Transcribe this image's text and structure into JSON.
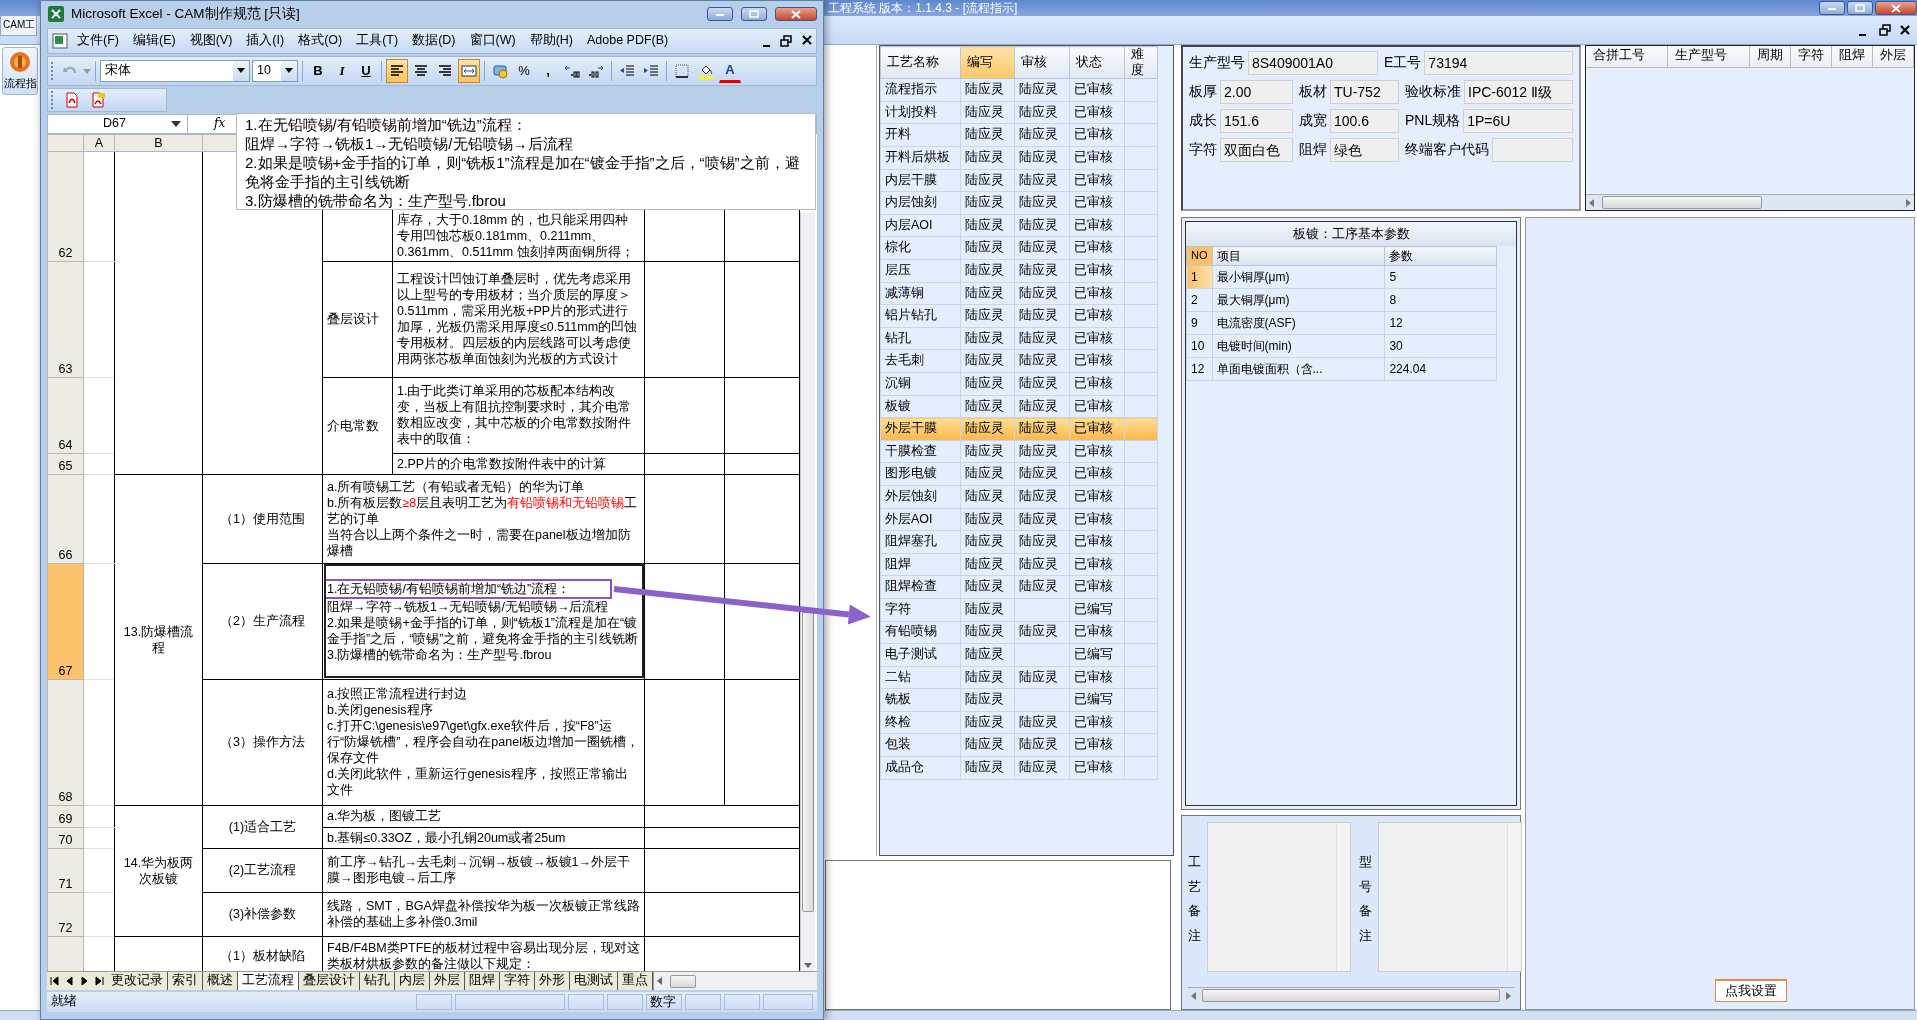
{
  "app": {
    "title": "工程系统  版本：1.1.4.3 - [流程指示]",
    "tab": "CAM工",
    "nav_button": "流程指"
  },
  "excel": {
    "title": "Microsoft Excel - CAM制作规范  [只读]",
    "menu": [
      "文件(F)",
      "编辑(E)",
      "视图(V)",
      "插入(I)",
      "格式(O)",
      "工具(T)",
      "数据(D)",
      "窗口(W)",
      "帮助(H)",
      "Adobe PDF(B)"
    ],
    "font": "宋体",
    "font_size": "10",
    "format_buttons": [
      {
        "kind": "bold",
        "label": "B",
        "pressed": false
      },
      {
        "kind": "italic",
        "label": "I",
        "pressed": false
      },
      {
        "kind": "underline",
        "label": "U",
        "pressed": false
      },
      {
        "kind": "align-left",
        "pressed": true
      },
      {
        "kind": "align-center",
        "pressed": false
      },
      {
        "kind": "align-right",
        "pressed": false
      },
      {
        "kind": "merge",
        "pressed": true
      },
      {
        "kind": "currency",
        "pressed": false
      },
      {
        "kind": "percent",
        "label": "%",
        "pressed": false
      },
      {
        "kind": "comma",
        "label": ",",
        "pressed": false
      },
      {
        "kind": "inc-decimal",
        "pressed": false
      },
      {
        "kind": "dec-decimal",
        "pressed": false
      },
      {
        "kind": "dec-indent",
        "pressed": false
      },
      {
        "kind": "inc-indent",
        "pressed": false
      },
      {
        "kind": "borders",
        "pressed": false
      },
      {
        "kind": "fill-color",
        "pressed": false
      },
      {
        "kind": "font-color",
        "label": "A",
        "pressed": false
      }
    ],
    "name_box": "D67",
    "function_label": "fx",
    "formula": [
      "1.在无铅喷锡/有铅喷锡前增加“铣边”流程：",
      "阻焊→字符→铣板1→无铅喷锡/无铅喷锡→后流程",
      "2.如果是喷锡+金手指的订单，则“铣板1”流程是加在“镀金手指”之后，“喷锡”之前，避免将金手指的主引线铣断",
      "3.防爆槽的铣带命名为：生产型号.fbrou"
    ],
    "column_headers": [
      "A",
      "B"
    ],
    "rows": [
      {
        "number": "62",
        "active": false,
        "cells": [
          {},
          {
            "rowspan": 4
          },
          {
            "rowspan": 4
          },
          {},
          {
            "text": "库存，大于0.18mm 的，也只能采用四种专用凹蚀芯板0.181mm、0.211mm、0.361mm、0.511mm 蚀刻掉两面铜所得；"
          },
          {},
          {}
        ]
      },
      {
        "number": "63",
        "active": false,
        "cells": [
          {},
          {
            "text": "叠层设计"
          },
          {
            "text": "工程设计凹蚀订单叠层时，优先考虑采用以上型号的专用板材；当介质层的厚度＞0.511mm，需采用光板+PP片的形式进行加厚，光板仍需采用厚度≤0.511mm的凹蚀专用板材。四层板的内层线路可以考虑使用两张芯板单面蚀刻为光板的方式设计"
          },
          {},
          {}
        ]
      },
      {
        "number": "64",
        "active": false,
        "cells": [
          {},
          {
            "text": "介电常数",
            "rowspan": 2
          },
          {
            "text": "1.由于此类订单采用的芯板配本结构改变，当板上有阻抗控制要求时，其介电常数相应改变，其中芯板的介电常数按附件表中的取值："
          },
          {},
          {}
        ]
      },
      {
        "number": "65",
        "active": false,
        "cells": [
          {},
          {
            "text": "2.PP片的介电常数按附件表中的计算"
          },
          {},
          {}
        ]
      },
      {
        "number": "66",
        "active": false,
        "cells": [
          {},
          {
            "text": "13.防爆槽流程",
            "rowspan": 3
          },
          {
            "text": "（1）使用范围"
          },
          {
            "colspan": 2,
            "lines": [
              {
                "text": "a.所有喷锡工艺（有铅或者无铅）的华为订单"
              },
              {
                "runs": [
                  {
                    "text": "b.所有板层数",
                    "red": false
                  },
                  {
                    "text": "≥8",
                    "red": true
                  },
                  {
                    "text": "层且表明工艺为",
                    "red": false
                  },
                  {
                    "text": "有铅喷锡和无铅喷锡",
                    "red": true
                  },
                  {
                    "text": "工艺的订单",
                    "red": false
                  }
                ]
              },
              {
                "text": "当符合以上两个条件之一时，需要在panel板边增加防爆槽"
              }
            ]
          },
          {},
          {}
        ]
      },
      {
        "number": "67",
        "active": true,
        "cells": [
          {},
          {
            "text": "（2）生产流程"
          },
          {
            "colspan": 2,
            "lines": [
              {
                "text": "1.在无铅喷锡/有铅喷锡前增加“铣边”流程：",
                "highlighted": true
              },
              {
                "text": "阻焊→字符→铣板1→无铅喷锡/无铅喷锡→后流程",
                "highlighted": false
              },
              {
                "text": "2.如果是喷锡+金手指的订单，则“铣板1”流程是加在“镀金手指”之后，“喷锡”之前，避免将金手指的主引线铣断",
                "highlighted": false
              },
              {
                "text": "3.防爆槽的铣带命名为：生产型号.fbrou",
                "highlighted": false
              }
            ]
          },
          {},
          {}
        ]
      },
      {
        "number": "68",
        "active": false,
        "cells": [
          {},
          {
            "text": "（3）操作方法"
          },
          {
            "colspan": 2,
            "lines": [
              {
                "text": "a.按照正常流程进行封边"
              },
              {
                "text": "b.关闭genesis程序"
              },
              {
                "text": "c.打开C:\\genesis\\e97\\get\\gfx.exe软件后，按“F8”运行“防爆铣槽”，程序会自动在panel板边增加一圈铣槽，保存文件"
              },
              {
                "text": "d.关闭此软件，重新运行genesis程序，按照正常输出文件"
              }
            ]
          },
          {},
          {}
        ]
      },
      {
        "number": "69",
        "active": false,
        "cells": [
          {},
          {
            "text": "14.华为板两次板镀",
            "rowspan": 4
          },
          {
            "text": "(1)适合工艺",
            "rowspan": 2
          },
          {
            "colspan": 2,
            "text": "a.华为板，图镀工艺"
          },
          {
            "colspan": 2
          }
        ]
      },
      {
        "number": "70",
        "active": false,
        "cells": [
          {},
          {
            "colspan": 2,
            "text": "b.基铜≤0.33OZ，最小孔铜20um或者25um"
          },
          {
            "colspan": 2
          }
        ]
      },
      {
        "number": "71",
        "active": false,
        "cells": [
          {},
          {
            "text": "(2)工艺流程"
          },
          {
            "colspan": 2,
            "text": "前工序→钻孔→去毛刺→沉铜→板镀→板镀1→外层干膜→图形电镀→后工序"
          },
          {
            "colspan": 2
          }
        ]
      },
      {
        "number": "72",
        "active": false,
        "cells": [
          {},
          {
            "text": "(3)补偿参数"
          },
          {
            "colspan": 2,
            "text": "线路，SMT，BGA焊盘补偿按华为板一次板镀正常线路补偿的基础上多补偿0.3mil"
          },
          {
            "colspan": 2
          }
        ]
      },
      {
        "active": false,
        "cells": [
          {},
          {},
          {
            "text": "（1）板材缺陷"
          },
          {
            "colspan": 2,
            "text": "F4B/F4BM类PTFE的板材过程中容易出现分层，现对这类板材烘板参数的备注做以下规定："
          },
          {
            "colspan": 2
          }
        ]
      }
    ],
    "sheet_tabs": [
      {
        "label": "更改记录",
        "selected": false
      },
      {
        "label": "索引",
        "selected": false
      },
      {
        "label": "概述",
        "selected": false
      },
      {
        "label": "工艺流程",
        "selected": true
      },
      {
        "label": "叠层设计",
        "selected": false
      },
      {
        "label": "钻孔",
        "selected": false
      },
      {
        "label": "内层",
        "selected": false
      },
      {
        "label": "外层",
        "selected": false
      },
      {
        "label": "阻焊",
        "selected": false
      },
      {
        "label": "字符",
        "selected": false
      },
      {
        "label": "外形",
        "selected": false
      },
      {
        "label": "电测试",
        "selected": false
      },
      {
        "label": "重点",
        "selected": false
      }
    ],
    "status": "就绪",
    "indicator": "数字"
  },
  "process_table": {
    "columns": [
      {
        "label": "工艺名称",
        "selected": false
      },
      {
        "label": "编写",
        "selected": true
      },
      {
        "label": "审核",
        "selected": false
      },
      {
        "label": "状态",
        "selected": false
      },
      {
        "label": "难度",
        "selected": false
      }
    ],
    "rows": [
      {
        "name": "流程指示",
        "writer": "陆应灵",
        "reviewer": "陆应灵",
        "status": "已审核",
        "selected": false
      },
      {
        "name": "计划投料",
        "writer": "陆应灵",
        "reviewer": "陆应灵",
        "status": "已审核",
        "selected": false
      },
      {
        "name": "开料",
        "writer": "陆应灵",
        "reviewer": "陆应灵",
        "status": "已审核",
        "selected": false
      },
      {
        "name": "开料后烘板",
        "writer": "陆应灵",
        "reviewer": "陆应灵",
        "status": "已审核",
        "selected": false
      },
      {
        "name": "内层干膜",
        "writer": "陆应灵",
        "reviewer": "陆应灵",
        "status": "已审核",
        "selected": false
      },
      {
        "name": "内层蚀刻",
        "writer": "陆应灵",
        "reviewer": "陆应灵",
        "status": "已审核",
        "selected": false
      },
      {
        "name": "内层AOI",
        "writer": "陆应灵",
        "reviewer": "陆应灵",
        "status": "已审核",
        "selected": false
      },
      {
        "name": "棕化",
        "writer": "陆应灵",
        "reviewer": "陆应灵",
        "status": "已审核",
        "selected": false
      },
      {
        "name": "层压",
        "writer": "陆应灵",
        "reviewer": "陆应灵",
        "status": "已审核",
        "selected": false
      },
      {
        "name": "减薄铜",
        "writer": "陆应灵",
        "reviewer": "陆应灵",
        "status": "已审核",
        "selected": false
      },
      {
        "name": "铝片钻孔",
        "writer": "陆应灵",
        "reviewer": "陆应灵",
        "status": "已审核",
        "selected": false
      },
      {
        "name": "钻孔",
        "writer": "陆应灵",
        "reviewer": "陆应灵",
        "status": "已审核",
        "selected": false
      },
      {
        "name": "去毛刺",
        "writer": "陆应灵",
        "reviewer": "陆应灵",
        "status": "已审核",
        "selected": false
      },
      {
        "name": "沉铜",
        "writer": "陆应灵",
        "reviewer": "陆应灵",
        "status": "已审核",
        "selected": false
      },
      {
        "name": "板镀",
        "writer": "陆应灵",
        "reviewer": "陆应灵",
        "status": "已审核",
        "selected": false
      },
      {
        "name": "外层干膜",
        "writer": "陆应灵",
        "reviewer": "陆应灵",
        "status": "已审核",
        "selected": true
      },
      {
        "name": "干膜检查",
        "writer": "陆应灵",
        "reviewer": "陆应灵",
        "status": "已审核",
        "selected": false
      },
      {
        "name": "图形电镀",
        "writer": "陆应灵",
        "reviewer": "陆应灵",
        "status": "已审核",
        "selected": false
      },
      {
        "name": "外层蚀刻",
        "writer": "陆应灵",
        "reviewer": "陆应灵",
        "status": "已审核",
        "selected": false
      },
      {
        "name": "外层AOI",
        "writer": "陆应灵",
        "reviewer": "陆应灵",
        "status": "已审核",
        "selected": false
      },
      {
        "name": "阻焊塞孔",
        "writer": "陆应灵",
        "reviewer": "陆应灵",
        "status": "已审核",
        "selected": false
      },
      {
        "name": "阻焊",
        "writer": "陆应灵",
        "reviewer": "陆应灵",
        "status": "已审核",
        "selected": false
      },
      {
        "name": "阻焊检查",
        "writer": "陆应灵",
        "reviewer": "陆应灵",
        "status": "已审核",
        "selected": false
      },
      {
        "name": "字符",
        "writer": "陆应灵",
        "status": "已编写",
        "selected": false
      },
      {
        "name": "有铅喷锡",
        "writer": "陆应灵",
        "reviewer": "陆应灵",
        "status": "已审核",
        "selected": false
      },
      {
        "name": "电子测试",
        "writer": "陆应灵",
        "status": "已编写",
        "selected": false
      },
      {
        "name": "二钻",
        "writer": "陆应灵",
        "reviewer": "陆应灵",
        "status": "已审核",
        "selected": false
      },
      {
        "name": "铣板",
        "writer": "陆应灵",
        "status": "已编写",
        "selected": false
      },
      {
        "name": "终检",
        "writer": "陆应灵",
        "reviewer": "陆应灵",
        "status": "已审核",
        "selected": false
      },
      {
        "name": "包装",
        "writer": "陆应灵",
        "reviewer": "陆应灵",
        "status": "已审核",
        "selected": false
      },
      {
        "name": "成品仓",
        "writer": "陆应灵",
        "reviewer": "陆应灵",
        "status": "已审核",
        "selected": false
      }
    ]
  },
  "product_info": [
    {
      "fields": [
        {
          "label": "生产型号",
          "value": "8S409001A0"
        },
        {
          "label": "E工号",
          "value": "73194"
        }
      ]
    },
    {
      "fields": [
        {
          "label": "板厚",
          "value": "2.00"
        },
        {
          "label": "板材",
          "value": "TU-752"
        },
        {
          "label": "验收标准",
          "value": "IPC-6012 Ⅱ级"
        }
      ]
    },
    {
      "fields": [
        {
          "label": "成长",
          "value": "151.6"
        },
        {
          "label": "成宽",
          "value": "100.6"
        },
        {
          "label": "PNL规格",
          "value": "1P=6U"
        }
      ]
    },
    {
      "fields": [
        {
          "label": "字符",
          "value": "双面白色"
        },
        {
          "label": "阻焊",
          "value": "绿色"
        },
        {
          "label": "终端客户代码"
        }
      ]
    }
  ],
  "merge_table": {
    "columns": [
      "合拼工号",
      "生产型号",
      "周期",
      "字符",
      "阻焊",
      "外层"
    ]
  },
  "params": {
    "title": "板镀：工序基本参数",
    "columns": [
      "NO",
      "项目",
      "参数"
    ],
    "rows": [
      {
        "no": "1",
        "item": "最小铜厚(μm)",
        "value": "5",
        "selected": true
      },
      {
        "no": "2",
        "item": "最大铜厚(μm)",
        "value": "8",
        "selected": false
      },
      {
        "no": "9",
        "item": "电流密度(ASF)",
        "value": "12",
        "selected": false
      },
      {
        "no": "10",
        "item": "电镀时间(min)",
        "value": "30",
        "selected": false
      },
      {
        "no": "12",
        "item": "单面电镀面积（含...",
        "value": "224.04",
        "selected": false
      }
    ]
  },
  "notes": [
    {
      "label": "工艺备注"
    },
    {
      "label": "型号备注"
    }
  ],
  "tooltip": "点我设置"
}
